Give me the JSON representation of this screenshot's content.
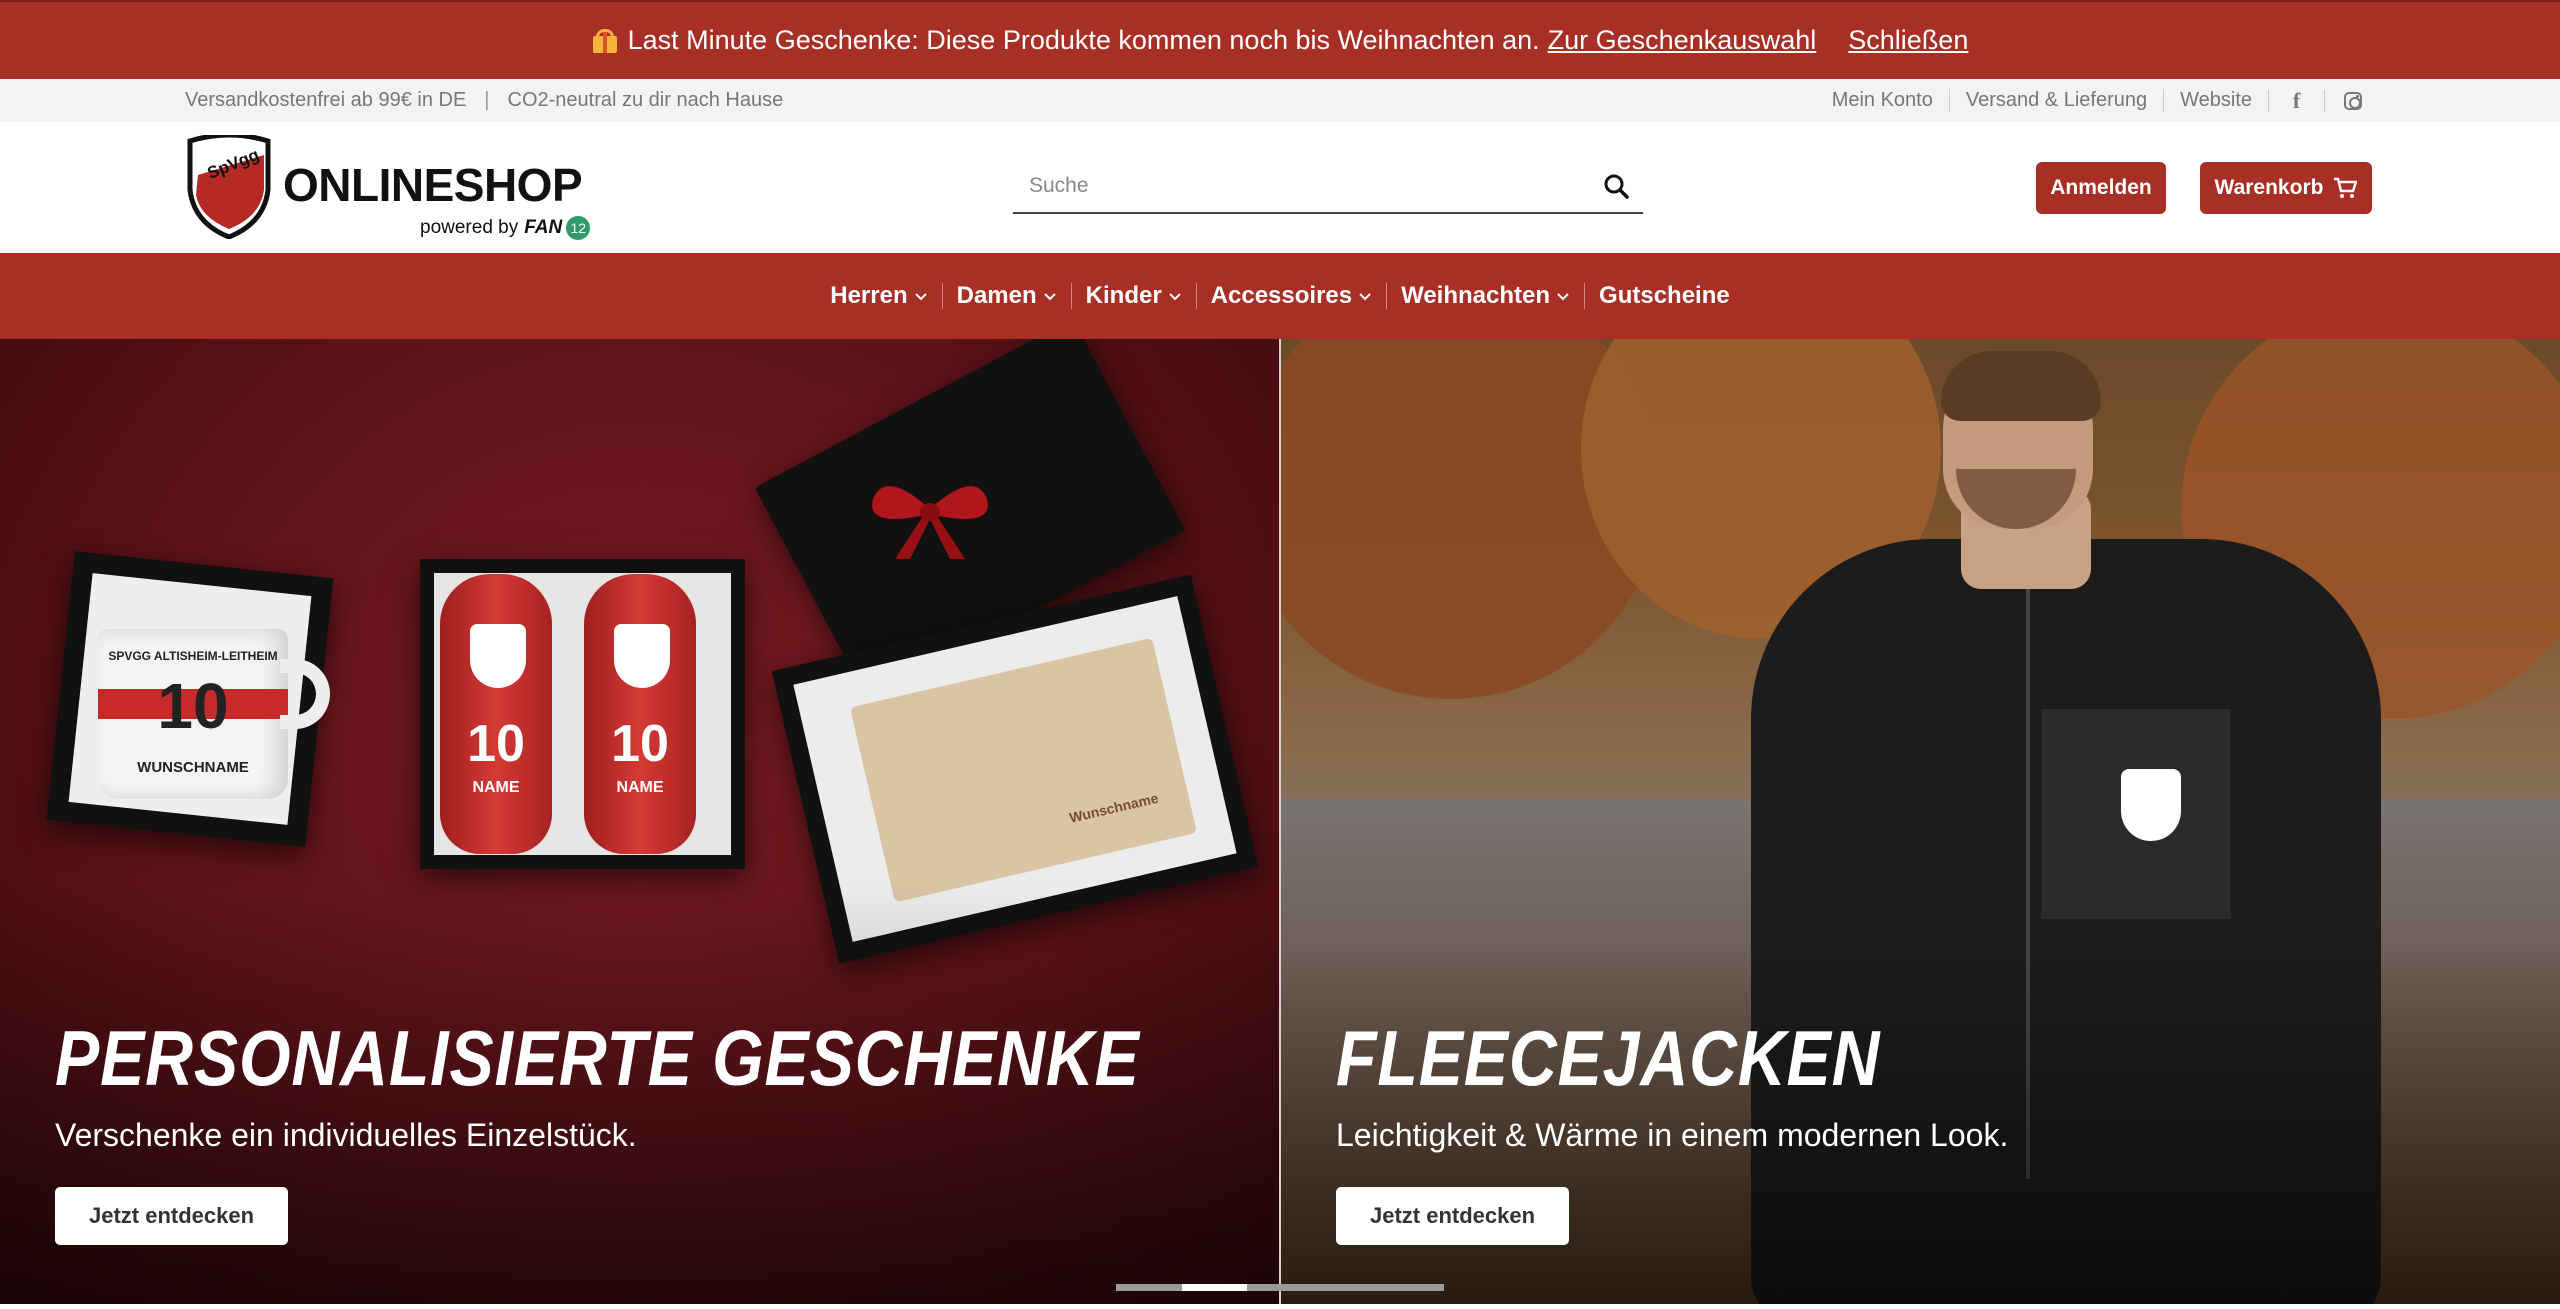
{
  "promo": {
    "message": "Last Minute Geschenke: Diese Produkte kommen noch bis Weihnachten an.",
    "link_label": "Zur Geschenkauswahl",
    "close_label": "Schließen"
  },
  "topbar": {
    "shipping_note": "Versandkostenfrei ab 99€ in DE",
    "separator": "|",
    "co2_note": "CO2-neutral zu dir nach Hause",
    "links": [
      "Mein Konto",
      "Versand & Lieferung",
      "Website"
    ],
    "social": [
      "facebook-icon",
      "instagram-icon"
    ]
  },
  "header": {
    "logo_text": "ONLINESHOP",
    "powered_by": "powered by",
    "powered_brand": "FAN",
    "powered_badge": "12",
    "search_placeholder": "Suche",
    "login_label": "Anmelden",
    "cart_label": "Warenkorb"
  },
  "nav": {
    "items": [
      "Herren",
      "Damen",
      "Kinder",
      "Accessoires",
      "Weihnachten",
      "Gutscheine"
    ]
  },
  "hero": {
    "left": {
      "title": "PERSONALISIERTE GESCHENKE",
      "subtitle": "Verschenke ein individuelles Einzelstück.",
      "button": "Jetzt entdecken",
      "mug_top": "SPVGG ALTISHEIM-LEITHEIM",
      "mug_number": "10",
      "mug_name": "WUNSCHNAME",
      "shin_number": "10",
      "shin_name": "NAME",
      "wood_text": "Wunschname"
    },
    "right": {
      "title": "FLEECEJACKEN",
      "subtitle": "Leichtigkeit & Wärme in einem modernen Look.",
      "button": "Jetzt entdecken"
    }
  },
  "colors": {
    "brand_red": "#a82f25",
    "topbar_bg": "#f3f3f3"
  },
  "slider": {
    "total": 5,
    "active": 2
  }
}
